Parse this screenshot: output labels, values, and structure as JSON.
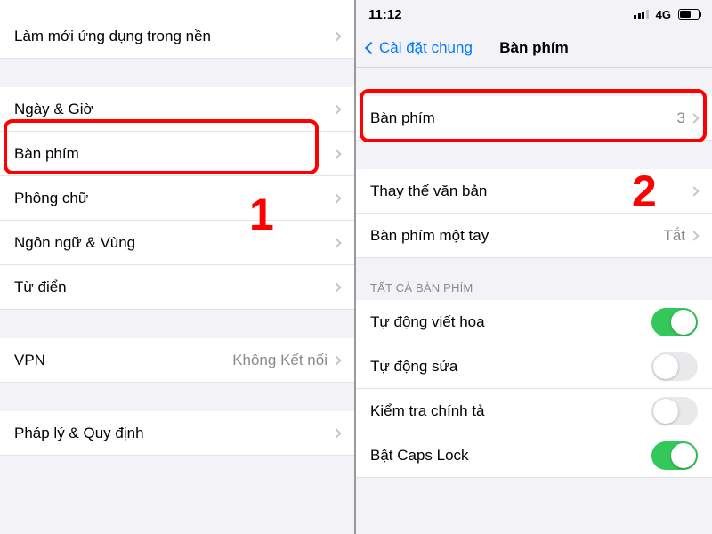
{
  "left": {
    "topCutoffHint": "",
    "rows": {
      "refresh": "Làm mới ứng dụng trong nền",
      "datetime": "Ngày & Giờ",
      "keyboard": "Bàn phím",
      "font": "Phông chữ",
      "language": "Ngôn ngữ & Vùng",
      "dictionary": "Từ điển",
      "vpn": "VPN",
      "vpnValue": "Không Kết nối",
      "legal": "Pháp lý & Quy định"
    },
    "step": "1"
  },
  "right": {
    "status": {
      "time": "11:12",
      "cell": "4G"
    },
    "nav": {
      "back": "Cài đặt chung",
      "title": "Bàn phím"
    },
    "rows": {
      "keyboards": "Bàn phím",
      "keyboardsCount": "3",
      "textReplace": "Thay thế văn bản",
      "oneHand": "Bàn phím một tay",
      "oneHandValue": "Tắt"
    },
    "sectionAll": "TẤT CÀ BÀN PHÍM",
    "toggles": {
      "autoCap": "Tự động viết hoa",
      "autoCorrect": "Tự động sửa",
      "spellCheck": "Kiểm tra chính tả",
      "capsLock": "Bật Caps Lock"
    },
    "toggleState": {
      "autoCap": true,
      "autoCorrect": false,
      "spellCheck": false,
      "capsLock": true
    },
    "step": "2"
  }
}
